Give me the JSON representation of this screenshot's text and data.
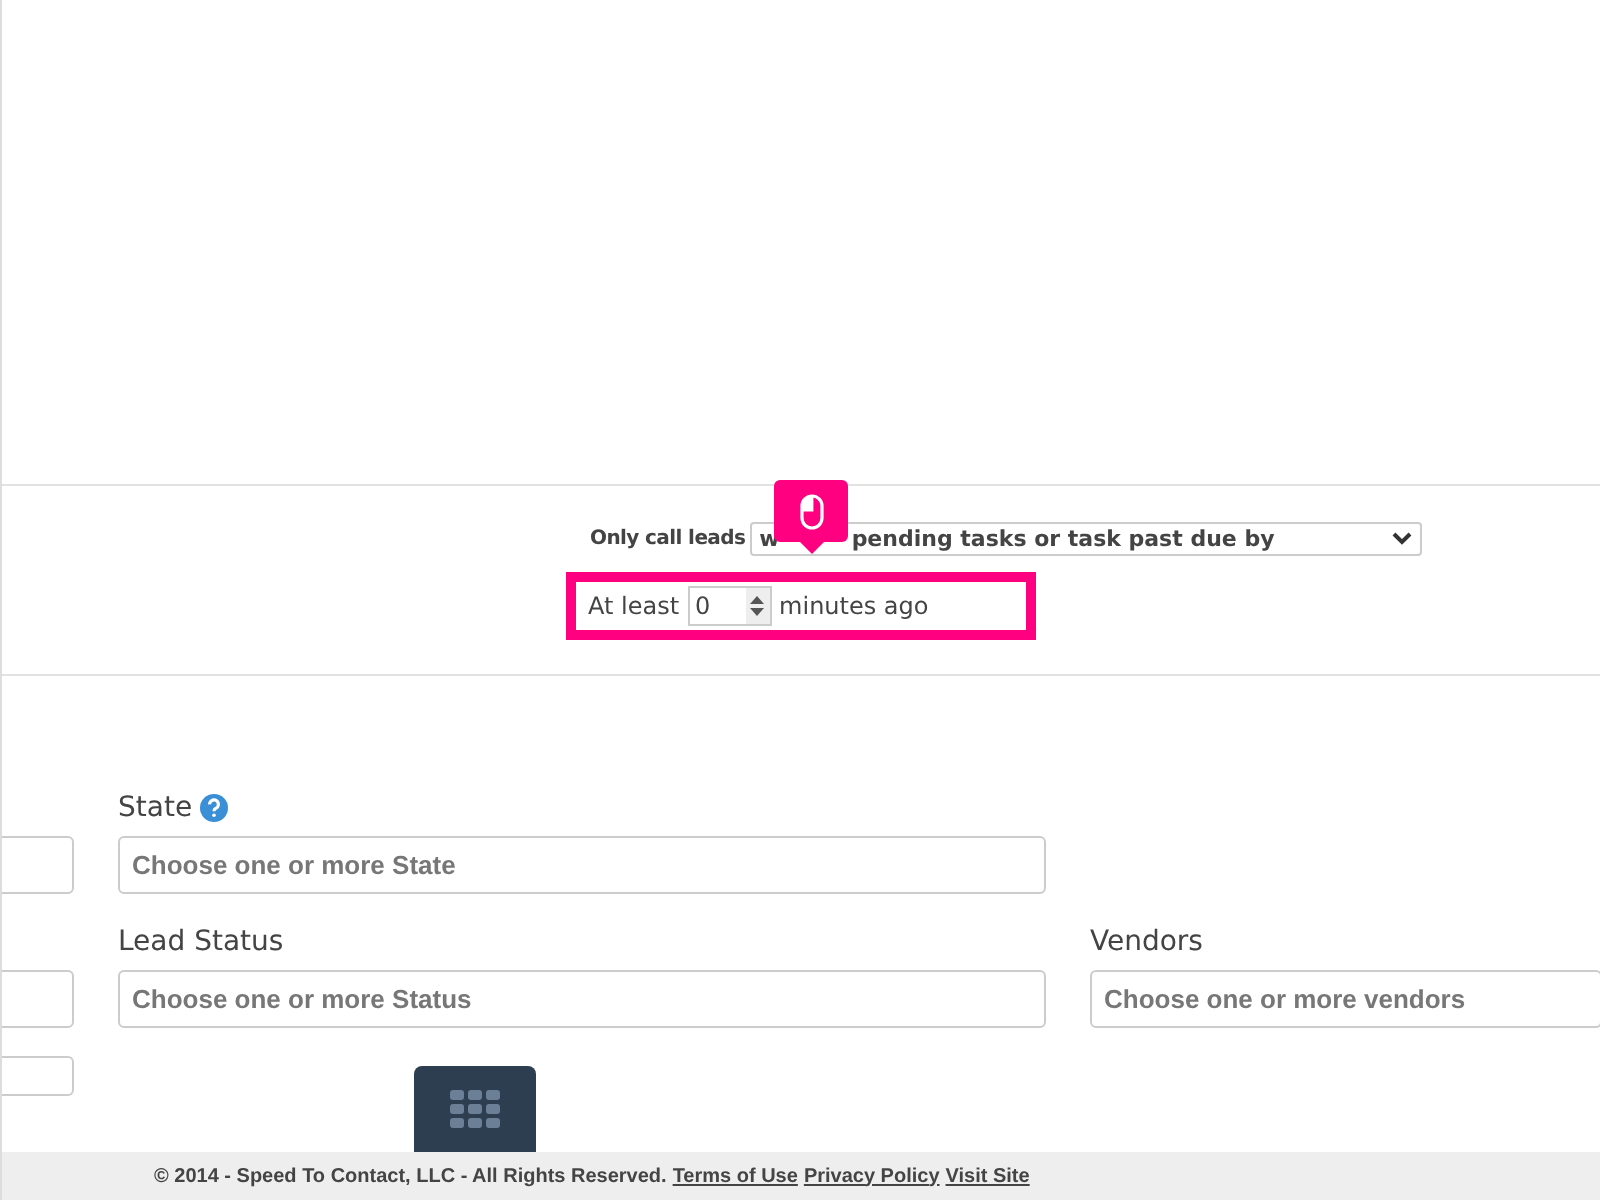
{
  "filter": {
    "label": "Only call leads",
    "select_start": "w",
    "select_rest": "pending tasks or task past due by",
    "prefix": "At least",
    "minutes": "0",
    "suffix": "minutes ago"
  },
  "field_rows": [
    {
      "fields": [
        {
          "label": "State",
          "help": true,
          "placeholder": "Choose one or more State"
        }
      ]
    },
    {
      "fields": [
        {
          "label": "Lead Status",
          "help": false,
          "placeholder": "Choose one or more Status"
        },
        {
          "label": "Vendors",
          "help": false,
          "placeholder": "Choose one or more vendors"
        }
      ]
    }
  ],
  "footer": {
    "copyright": "© 2014 - Speed To Contact, LLC - All Rights Reserved.",
    "links": [
      "Terms of Use",
      "Privacy Policy",
      "Visit Site"
    ]
  }
}
